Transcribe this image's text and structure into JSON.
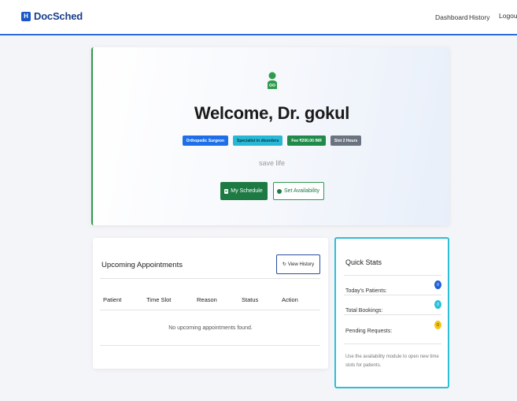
{
  "nav": {
    "brand": "DocSched",
    "brand_icon": "H",
    "links": {
      "dashboard": "Dashboard",
      "history": "History",
      "logout": "Logout"
    }
  },
  "hero": {
    "icon": "doctor-icon",
    "welcome": "Welcome, Dr. gokul",
    "badges": {
      "specialty": "Orthopedic Surgeon",
      "expertise": "Specialist in disorders",
      "fee": "Fee ₹200.00 INR",
      "slot": "Slot 2 Hours"
    },
    "tagline": "save life",
    "buttons": {
      "schedule": "My Schedule",
      "availability": "Set Availability"
    }
  },
  "appointments": {
    "title": "Upcoming Appointments",
    "history_button": "View History",
    "columns": [
      "Patient",
      "Time Slot",
      "Reason",
      "Status",
      "Action"
    ],
    "empty_message": "No upcoming appointments found."
  },
  "stats": {
    "title": "Quick Stats",
    "rows": [
      {
        "label": "Today's Patients:",
        "value": "0"
      },
      {
        "label": "Total Bookings:",
        "value": "0"
      },
      {
        "label": "Pending Requests:",
        "value": "0"
      }
    ],
    "note": "Use the availability module to open new time slots for patients."
  },
  "colors": {
    "primary": "#1a56c8",
    "success": "#1d7a43",
    "info": "#2bbfd8",
    "warning": "#f5c518",
    "secondary": "#6b7280"
  }
}
